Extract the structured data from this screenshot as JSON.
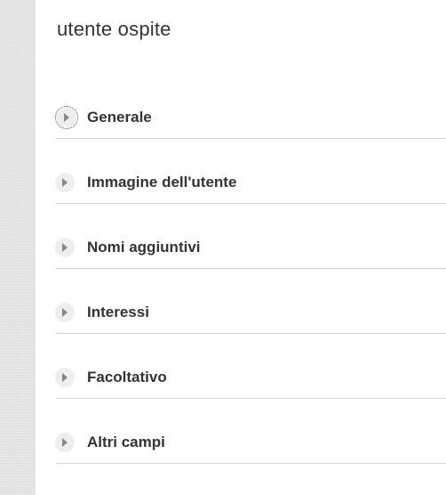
{
  "page": {
    "title": "utente ospite"
  },
  "sections": [
    {
      "label": "Generale",
      "expanded": false,
      "focused": true
    },
    {
      "label": "Immagine dell'utente",
      "expanded": false,
      "focused": false
    },
    {
      "label": "Nomi aggiuntivi",
      "expanded": false,
      "focused": false
    },
    {
      "label": "Interessi",
      "expanded": false,
      "focused": false
    },
    {
      "label": "Facoltativo",
      "expanded": false,
      "focused": false
    },
    {
      "label": "Altri campi",
      "expanded": false,
      "focused": false
    }
  ],
  "icons": {
    "section_toggle": "caret-right-icon"
  },
  "colors": {
    "text": "#333333",
    "divider": "#d4d4d4",
    "icon_bg": "#eeeeee",
    "icon_arrow": "#888888",
    "sidebar_strip": "#e6e6e6"
  }
}
